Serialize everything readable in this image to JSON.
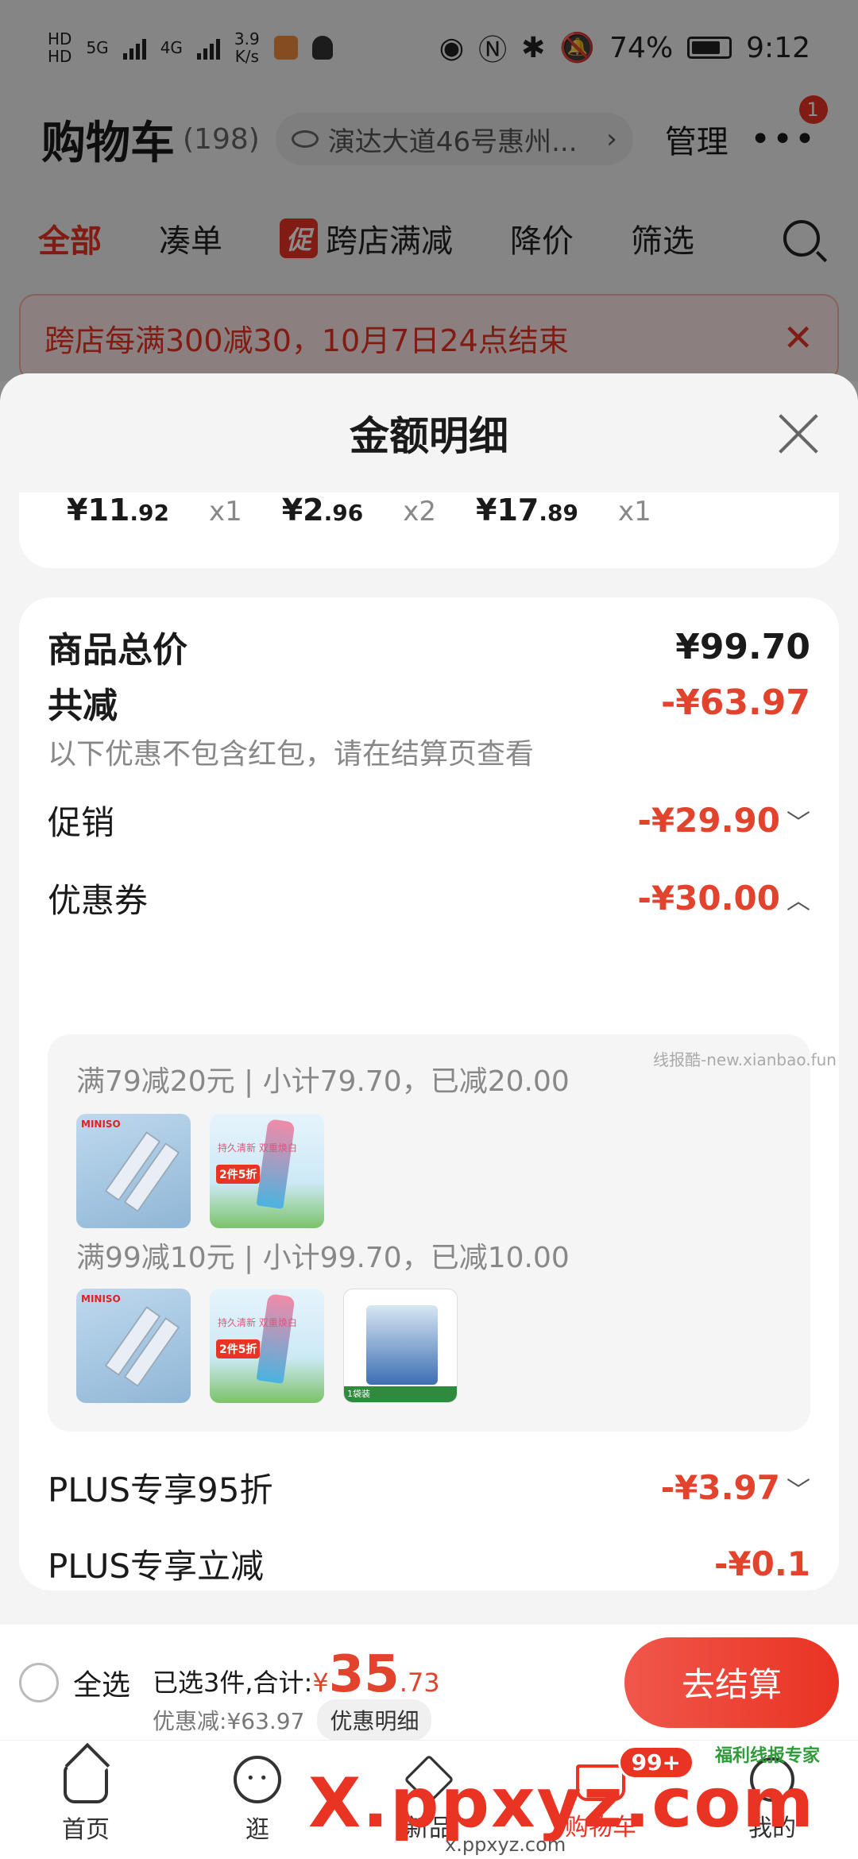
{
  "status_bar": {
    "net_top": "HD",
    "net_bottom": "HD",
    "gen1": "5G",
    "gen2": "4G",
    "speed_value": "3.9",
    "speed_unit": "K/s",
    "battery": "74%",
    "time": "9:12"
  },
  "header": {
    "title": "购物车",
    "count": "(198)",
    "address": "演达大道46号惠州...",
    "manage": "管理",
    "more_badge": "1"
  },
  "tabs": [
    "全部",
    "凑单",
    "跨店满减",
    "降价",
    "筛选"
  ],
  "tab_promo_tag": "促",
  "promo_banner": {
    "text": "跨店每满300减30，10月7日24点结束"
  },
  "sheet": {
    "title": "金额明细",
    "items": [
      {
        "yen": "¥",
        "int": "11",
        "dec": ".92",
        "qty": "x1"
      },
      {
        "yen": "¥",
        "int": "2",
        "dec": ".96",
        "qty": "x2"
      },
      {
        "yen": "¥",
        "int": "17",
        "dec": ".89",
        "qty": "x1"
      }
    ],
    "total_label": "商品总价",
    "total_value": "¥99.70",
    "reduce_label": "共减",
    "reduce_value": "-¥63.97",
    "reduce_note": "以下优惠不包含红包，请在结算页查看",
    "promo_label": "促销",
    "promo_value": "-¥29.90",
    "coupon_label": "优惠券",
    "coupon_value": "-¥30.00",
    "coupon_groups": [
      {
        "title": "满79减20元 | 小计79.70，已减20.00"
      },
      {
        "title": "满99减10元 | 小计99.70，已减10.00"
      }
    ],
    "plus_discount_label": "PLUS专享95折",
    "plus_discount_value": "-¥3.97",
    "plus_cut_label": "PLUS专享立减",
    "plus_cut_value": "-¥0.1",
    "side_watermark": "线报酷-new.xianbao.fun"
  },
  "thumbs": {
    "brand": "MINISO",
    "cleanser_text": "持久清新 双重焕白",
    "cleanser_tag": "2件5折",
    "pest_strip": "1袋装"
  },
  "checkout": {
    "select_all": "全选",
    "selected_label": "已选3件,合计:",
    "yen": "¥",
    "amount_int": "35",
    "amount_dec": ".73",
    "discount": "优惠减:¥63.97",
    "detail_btn": "优惠明细",
    "checkout_btn": "去结算"
  },
  "bottom_nav": [
    {
      "label": "首页"
    },
    {
      "label": "逛"
    },
    {
      "label": "新品"
    },
    {
      "label": "购物车",
      "badge": "99+"
    },
    {
      "label": "我的"
    }
  ],
  "watermarks": {
    "big": "X.ppxyz.com",
    "small": "x.ppxyz.com",
    "tag": "福利线报专家"
  },
  "colors": {
    "accent": "#e93323",
    "price_red": "#e1432d"
  }
}
